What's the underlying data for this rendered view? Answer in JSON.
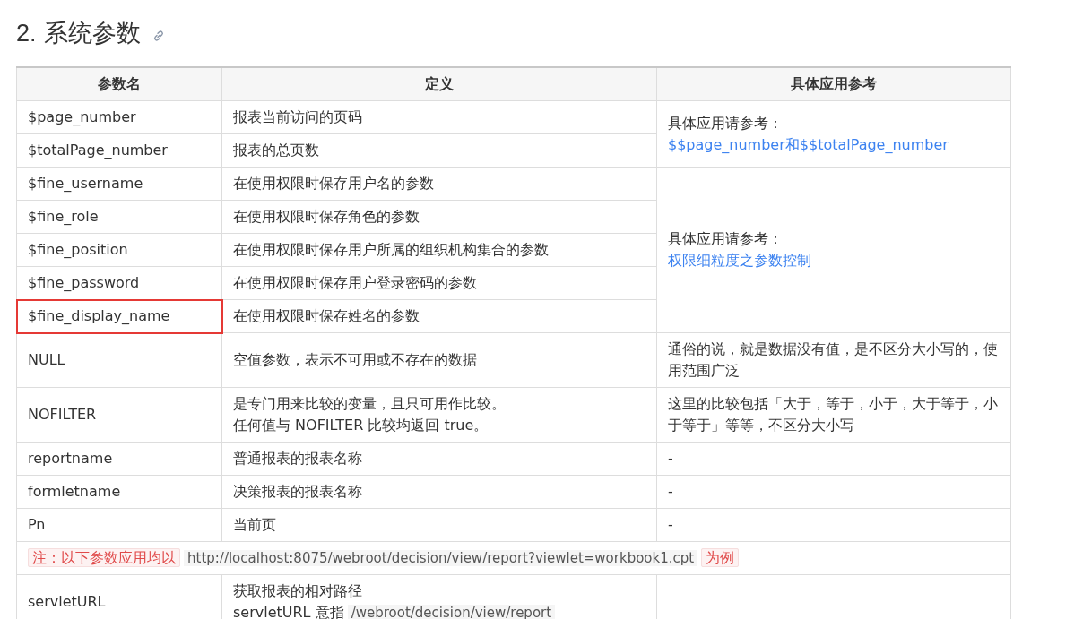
{
  "heading": {
    "number": "2.",
    "title": "系统参数"
  },
  "table": {
    "columns": [
      "参数名",
      "定义",
      "具体应用参考"
    ],
    "sections": [
      {
        "kind": "group",
        "reference": [
          {
            "kind": "text",
            "text": "具体应用请参考："
          },
          {
            "kind": "link",
            "text": "$$page_number和$$totalPage_number"
          }
        ],
        "rows": [
          {
            "name": "$page_number",
            "definition": [
              "报表当前访问的页码"
            ],
            "highlighted": false
          },
          {
            "name": "$totalPage_number",
            "definition": [
              "报表的总页数"
            ],
            "highlighted": false
          }
        ]
      },
      {
        "kind": "group",
        "reference": [
          {
            "kind": "text",
            "text": "具体应用请参考："
          },
          {
            "kind": "link",
            "text": "权限细粒度之参数控制"
          }
        ],
        "rows": [
          {
            "name": "$fine_username",
            "definition": [
              "在使用权限时保存用户名的参数"
            ],
            "highlighted": false
          },
          {
            "name": "$fine_role",
            "definition": [
              "在使用权限时保存角色的参数"
            ],
            "highlighted": false
          },
          {
            "name": "$fine_position",
            "definition": [
              "在使用权限时保存用户所属的组织机构集合的参数"
            ],
            "highlighted": false
          },
          {
            "name": "$fine_password",
            "definition": [
              "在使用权限时保存用户登录密码的参数"
            ],
            "highlighted": false
          },
          {
            "name": "$fine_display_name",
            "definition": [
              "在使用权限时保存姓名的参数"
            ],
            "highlighted": true
          }
        ]
      },
      {
        "kind": "group",
        "reference": [
          {
            "kind": "text",
            "text": "通俗的说，就是数据没有值，是不区分大小写的，使用范围广泛"
          }
        ],
        "rows": [
          {
            "name": "NULL",
            "definition": [
              "空值参数，表示不可用或不存在的数据"
            ],
            "highlighted": false
          }
        ]
      },
      {
        "kind": "group",
        "reference": [
          {
            "kind": "text",
            "text": "这里的比较包括「大于，等于，小于，大于等于，小于等于」等等，不区分大小写"
          }
        ],
        "rows": [
          {
            "name": "NOFILTER",
            "definition": [
              "是专门用来比较的变量，且只可用作比较。",
              "任何值与 NOFILTER 比较均返回 true。"
            ],
            "highlighted": false
          }
        ]
      },
      {
        "kind": "group",
        "reference": [
          {
            "kind": "text",
            "text": "-"
          }
        ],
        "rows": [
          {
            "name": "reportname",
            "definition": [
              "普通报表的报表名称"
            ],
            "highlighted": false
          }
        ]
      },
      {
        "kind": "group",
        "reference": [
          {
            "kind": "text",
            "text": "-"
          }
        ],
        "rows": [
          {
            "name": "formletname",
            "definition": [
              "决策报表的报表名称"
            ],
            "highlighted": false
          }
        ]
      },
      {
        "kind": "group",
        "reference": [
          {
            "kind": "text",
            "text": "-"
          }
        ],
        "rows": [
          {
            "name": "Pn",
            "definition": [
              "当前页"
            ],
            "highlighted": false
          }
        ]
      },
      {
        "kind": "note",
        "parts": [
          {
            "kind": "mark",
            "text": "注：以下参数应用均以"
          },
          {
            "kind": "code",
            "text": "http://localhost:8075/webroot/decision/view/report?viewlet=workbook1.cpt"
          },
          {
            "kind": "mark",
            "text": "为例"
          }
        ]
      },
      {
        "kind": "group",
        "rows": [
          {
            "name": "servletURL",
            "definition": [
              "获取报表的相对路径",
              [
                {
                  "kind": "text",
                  "text": "servletURL 意指"
                },
                {
                  "kind": "code",
                  "text": "/webroot/decision/view/report"
                }
              ]
            ],
            "highlighted": false
          }
        ]
      }
    ]
  }
}
